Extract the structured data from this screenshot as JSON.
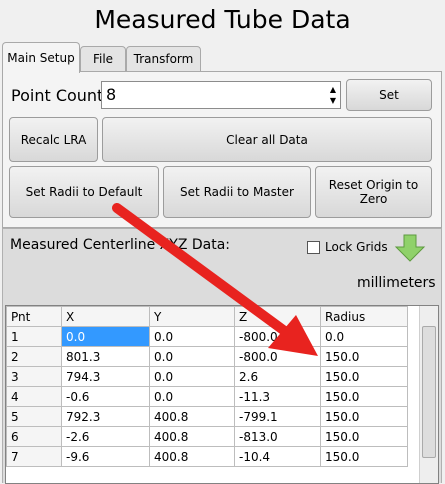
{
  "title": "Measured Tube Data",
  "tabs": [
    "Main Setup",
    "File",
    "Transform"
  ],
  "setup": {
    "point_count_label": "Point Count",
    "point_count_value": "8",
    "set_label": "Set",
    "recalc_label": "Recalc LRA",
    "clear_label": "Clear all Data",
    "radii_default_label": "Set Radii to Default",
    "radii_master_label": "Set Radii to Master",
    "reset_origin_label": "Reset Origin to Zero"
  },
  "centerline": {
    "title": "Measured Centerline XYZ Data:",
    "lock_grids_label": "Lock Grids",
    "units": "millimeters"
  },
  "table": {
    "headers": [
      "Pnt",
      "X",
      "Y",
      "Z",
      "Radius"
    ],
    "rows": [
      [
        "1",
        "0.0",
        "0.0",
        "-800.0",
        "0.0"
      ],
      [
        "2",
        "801.3",
        "0.0",
        "-800.0",
        "150.0"
      ],
      [
        "3",
        "794.3",
        "0.0",
        "2.6",
        "150.0"
      ],
      [
        "4",
        "-0.6",
        "0.0",
        "-11.3",
        "150.0"
      ],
      [
        "5",
        "792.3",
        "400.8",
        "-799.1",
        "150.0"
      ],
      [
        "6",
        "-2.6",
        "400.8",
        "-813.0",
        "150.0"
      ],
      [
        "7",
        "-9.6",
        "400.8",
        "-10.4",
        "150.0"
      ]
    ]
  },
  "colors": {
    "annotation_arrow": "#e8231f",
    "selected_cell": "#3399ff",
    "down_arrow": "#8fd16a"
  },
  "icons": [
    "down-arrow-icon",
    "spin-up-icon",
    "spin-down-icon"
  ]
}
